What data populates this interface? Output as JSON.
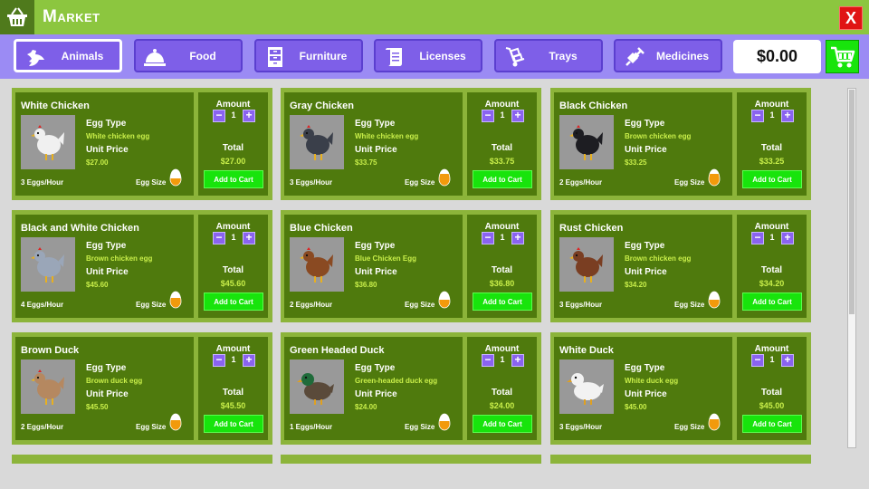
{
  "window": {
    "title": "Market",
    "close_label": "X"
  },
  "tabs": [
    {
      "label": "Animals",
      "icon": "bird-icon",
      "active": true
    },
    {
      "label": "Food",
      "icon": "food-dish-icon",
      "active": false
    },
    {
      "label": "Furniture",
      "icon": "cabinet-icon",
      "active": false
    },
    {
      "label": "Licenses",
      "icon": "scroll-icon",
      "active": false
    },
    {
      "label": "Trays",
      "icon": "hand-truck-icon",
      "active": false
    },
    {
      "label": "Medicines",
      "icon": "syringe-icon",
      "active": false
    }
  ],
  "wallet": {
    "balance": "$0.00"
  },
  "labels": {
    "egg_type": "Egg Type",
    "unit_price": "Unit Price",
    "egg_size": "Egg Size",
    "amount": "Amount",
    "total": "Total",
    "add_to_cart": "Add to Cart",
    "minus": "−",
    "plus": "+"
  },
  "colors": {
    "accent_green": "#18e40c",
    "tab_purple": "#7e5fe8",
    "card_green": "#4f7a0d",
    "price_text": "#c9ef4a"
  },
  "products": [
    {
      "name": "White Chicken",
      "egg_type": "White chicken egg",
      "unit_price": "$27.00",
      "rate": "3 Eggs/Hour",
      "amount": "1",
      "total": "$27.00",
      "bird": "chicken",
      "body": "#f0f0f0",
      "egg_fill": 0.45
    },
    {
      "name": "Gray Chicken",
      "egg_type": "White chicken egg",
      "unit_price": "$33.75",
      "rate": "3 Eggs/Hour",
      "amount": "1",
      "total": "$33.75",
      "bird": "chicken",
      "body": "#3a3f4a",
      "egg_fill": 0.7
    },
    {
      "name": "Black Chicken",
      "egg_type": "Brown chicken egg",
      "unit_price": "$33.25",
      "rate": "2 Eggs/Hour",
      "amount": "1",
      "total": "$33.25",
      "bird": "chicken",
      "body": "#1d1d22",
      "egg_fill": 0.7
    },
    {
      "name": "Black and White Chicken",
      "egg_type": "Brown chicken egg",
      "unit_price": "$45.60",
      "rate": "4 Eggs/Hour",
      "amount": "1",
      "total": "$45.60",
      "bird": "chicken",
      "body": "#9aa6b8",
      "egg_fill": 0.6
    },
    {
      "name": "Blue Chicken",
      "egg_type": "Blue Chicken Egg",
      "unit_price": "$36.80",
      "rate": "2 Eggs/Hour",
      "amount": "1",
      "total": "$36.80",
      "bird": "chicken",
      "body": "#8a4a22",
      "egg_fill": 0.5
    },
    {
      "name": "Rust Chicken",
      "egg_type": "Brown chicken egg",
      "unit_price": "$34.20",
      "rate": "3 Eggs/Hour",
      "amount": "1",
      "total": "$34.20",
      "bird": "chicken",
      "body": "#7a3e22",
      "egg_fill": 0.5
    },
    {
      "name": "Brown Duck",
      "egg_type": "Brown duck egg",
      "unit_price": "$45.50",
      "rate": "2 Eggs/Hour",
      "amount": "1",
      "total": "$45.50",
      "bird": "chicken",
      "body": "#b58860",
      "egg_fill": 0.6
    },
    {
      "name": "Green Headed Duck",
      "egg_type": "Green-headed duck egg",
      "unit_price": "$24.00",
      "rate": "1 Eggs/Hour",
      "amount": "1",
      "total": "$24.00",
      "bird": "duck",
      "body": "#5a4a3a",
      "head": "#1f6b3a",
      "egg_fill": 0.55
    },
    {
      "name": "White Duck",
      "egg_type": "White duck egg",
      "unit_price": "$45.00",
      "rate": "3 Eggs/Hour",
      "amount": "1",
      "total": "$45.00",
      "bird": "duck",
      "body": "#f2f2f2",
      "head": "#f2f2f2",
      "egg_fill": 0.65
    }
  ]
}
